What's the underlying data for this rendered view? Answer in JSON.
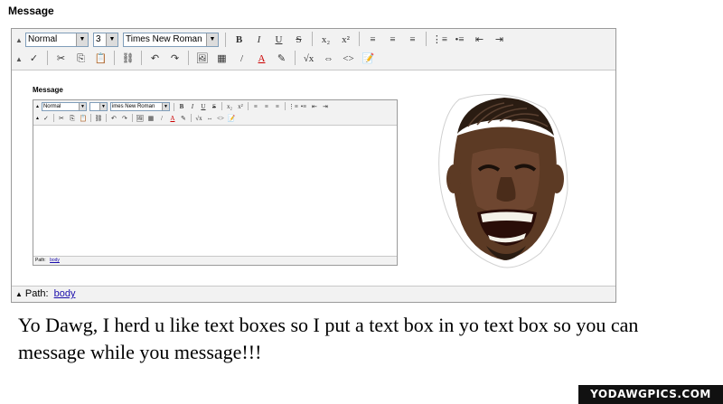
{
  "outer": {
    "label": "Message",
    "format_select": "Normal",
    "size_select": "3",
    "font_select": "Times New Roman",
    "buttons_row1": [
      {
        "name": "bold-button",
        "glyph": "B"
      },
      {
        "name": "italic-button",
        "glyph": "I"
      },
      {
        "name": "underline-button",
        "glyph": "U"
      },
      {
        "name": "strikethrough-button",
        "glyph": "S"
      },
      {
        "name": "subscript-button",
        "glyph": "x₂"
      },
      {
        "name": "superscript-button",
        "glyph": "x²"
      },
      {
        "name": "align-left-button",
        "glyph": "≡"
      },
      {
        "name": "align-center-button",
        "glyph": "≡"
      },
      {
        "name": "align-right-button",
        "glyph": "≡"
      },
      {
        "name": "ordered-list-button",
        "glyph": "⋮≡"
      },
      {
        "name": "unordered-list-button",
        "glyph": "•≡"
      },
      {
        "name": "outdent-button",
        "glyph": "⇤"
      },
      {
        "name": "indent-button",
        "glyph": "⇥"
      }
    ],
    "buttons_row2": [
      {
        "name": "spellcheck-icon",
        "glyph": "✓"
      },
      {
        "name": "cut-icon",
        "glyph": "✂"
      },
      {
        "name": "copy-icon",
        "glyph": "⎘"
      },
      {
        "name": "paste-icon",
        "glyph": "📋"
      },
      {
        "name": "link-icon",
        "glyph": "⛓"
      },
      {
        "name": "undo-icon",
        "glyph": "↶"
      },
      {
        "name": "redo-icon",
        "glyph": "↷"
      },
      {
        "name": "image-icon",
        "glyph": "🖼"
      },
      {
        "name": "table-icon",
        "glyph": "▦"
      },
      {
        "name": "hr-icon",
        "glyph": "/"
      },
      {
        "name": "text-color-icon",
        "glyph": "A"
      },
      {
        "name": "highlight-icon",
        "glyph": "✎"
      },
      {
        "name": "math-icon",
        "glyph": "√x"
      },
      {
        "name": "direction-icon",
        "glyph": "⇔"
      },
      {
        "name": "code-icon",
        "glyph": "<>"
      },
      {
        "name": "edit-source-icon",
        "glyph": "📝"
      }
    ],
    "status_path_label": "Path:",
    "status_path_value": "body"
  },
  "inner": {
    "label": "Message",
    "format_select": "Normal",
    "size_select": "",
    "font_select": "imes New Roman",
    "status_path_label": "Path:",
    "status_path_value": "body"
  },
  "caption": "Yo Dawg, I herd u like text boxes so I put a text box in yo text box so you can message while you message!!!",
  "watermark": "YODAWGPICS.COM",
  "colors": {
    "toolbar_bg": "#f2f2f2",
    "border": "#9a9a9a",
    "link": "#1a0dab",
    "watermark_bg": "#111111"
  }
}
